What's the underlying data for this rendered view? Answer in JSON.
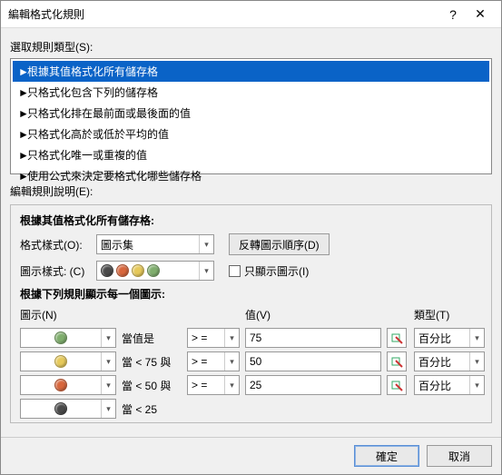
{
  "title": "編輯格式化規則",
  "section_select_type": "選取規則類型(S):",
  "rule_types": [
    "根據其值格式化所有儲存格",
    "只格式化包含下列的儲存格",
    "只格式化排在最前面或最後面的值",
    "只格式化高於或低於平均的值",
    "只格式化唯一或重複的值",
    "使用公式來決定要格式化哪些儲存格"
  ],
  "section_edit_desc": "編輯規則說明(E):",
  "fieldset_legend": "根據其值格式化所有儲存格:",
  "format_style_label": "格式樣式(O):",
  "format_style_value": "圖示集",
  "reverse_btn": "反轉圖示順序(D)",
  "icon_style_label": "圖示樣式: (C)",
  "show_icon_only": "只顯示圖示(I)",
  "sub_legend": "根據下列規則顯示每一個圖示:",
  "col_icon": "圖示(N)",
  "col_value": "值(V)",
  "col_type": "類型(T)",
  "rows": [
    {
      "color": "#7fae6d",
      "label": "當值是",
      "op": "> =",
      "val": "75",
      "type": "百分比"
    },
    {
      "color": "#e6c95a",
      "label": "當 < 75 與",
      "op": "> =",
      "val": "50",
      "type": "百分比"
    },
    {
      "color": "#d8663c",
      "label": "當 < 50 與",
      "op": "> =",
      "val": "25",
      "type": "百分比"
    },
    {
      "color": "#4a4a4a",
      "label": "當 < 25",
      "op": "",
      "val": "",
      "type": ""
    }
  ],
  "ok": "確定",
  "cancel": "取消"
}
